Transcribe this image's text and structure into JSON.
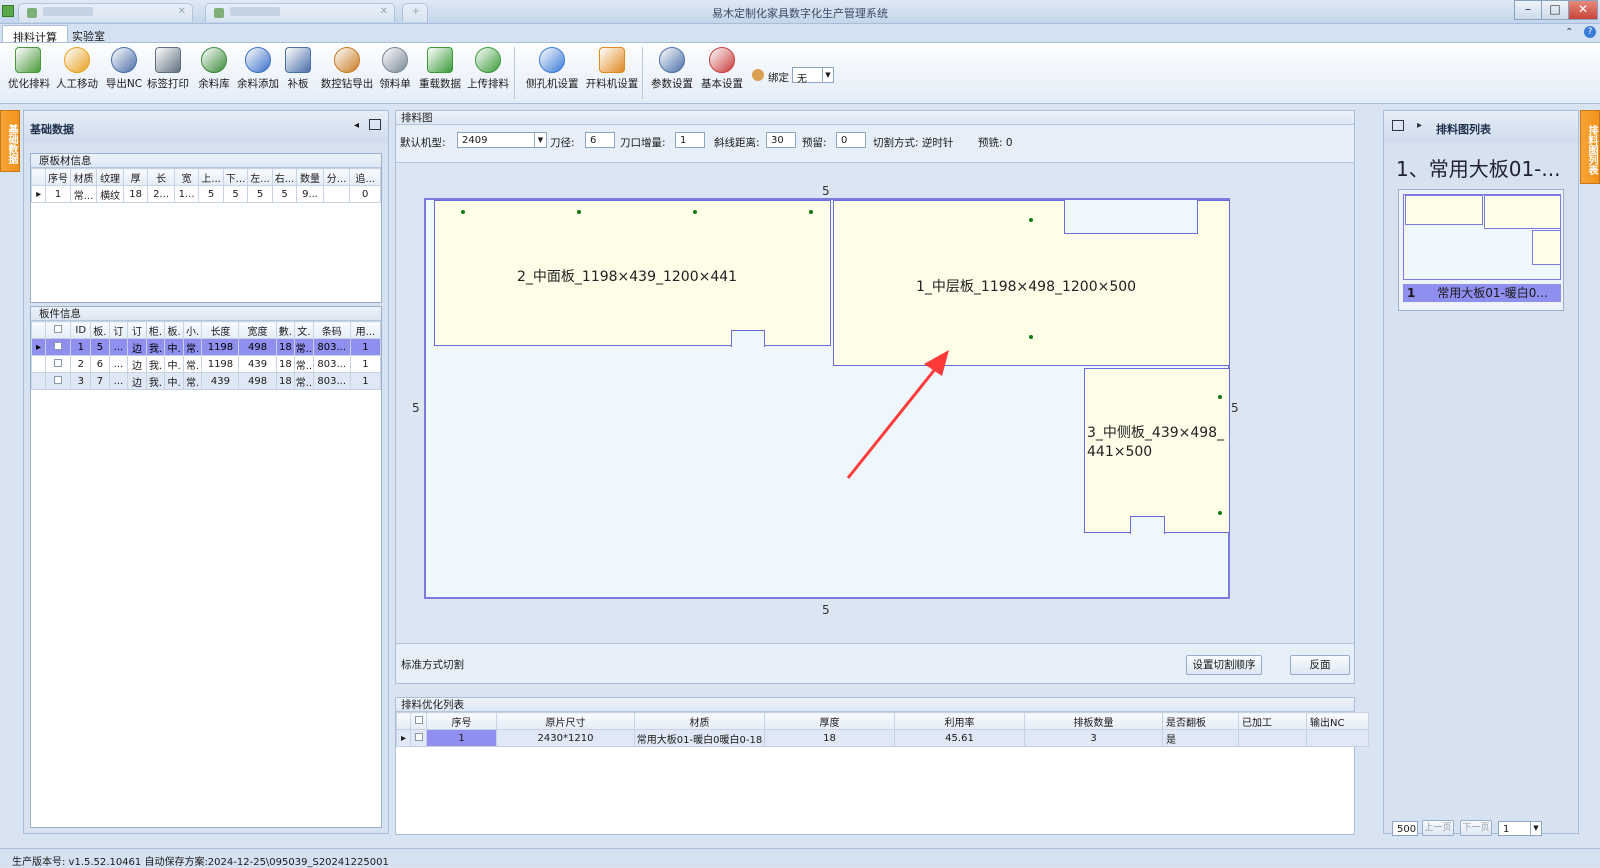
{
  "window": {
    "title": "易木定制化家具数字化生产管理系统"
  },
  "ribbon_tabs": [
    "排料计算",
    "实验室"
  ],
  "toolbar": {
    "buttons": [
      {
        "label": "优化排料",
        "icon": "optimize-icon",
        "color": "#4a9a3a"
      },
      {
        "label": "人工移动",
        "icon": "move-icon",
        "color": "#e8a020"
      },
      {
        "label": "导出NC",
        "icon": "export-nc-icon",
        "color": "#4a6fa8"
      },
      {
        "label": "标签打印",
        "icon": "printer-icon",
        "color": "#607080"
      },
      {
        "label": "余料库",
        "icon": "remnant-store-icon",
        "color": "#3a8a3a"
      },
      {
        "label": "余料添加",
        "icon": "add-circle-icon",
        "color": "#3a6fc8"
      },
      {
        "label": "补板",
        "icon": "patch-board-icon",
        "color": "#4a6fa8"
      },
      {
        "label": "数控钻导出",
        "icon": "drill-export-icon",
        "color": "#c87a20"
      },
      {
        "label": "领料单",
        "icon": "material-slip-icon",
        "color": "#7a8898"
      },
      {
        "label": "重载数据",
        "icon": "reload-icon",
        "color": "#3a9a3a"
      },
      {
        "label": "上传排料",
        "icon": "upload-icon",
        "color": "#3a9a3a"
      },
      {
        "label": "侧孔机设置",
        "icon": "side-drill-icon",
        "color": "#3a7ad8"
      },
      {
        "label": "开料机设置",
        "icon": "cutter-settings-icon",
        "color": "#e08a20"
      },
      {
        "label": "参数设置",
        "icon": "params-icon",
        "color": "#4a6fa8"
      },
      {
        "label": "基本设置",
        "icon": "tools-icon",
        "color": "#c83a3a"
      }
    ],
    "bind_label": "绑定",
    "bind_value": "无"
  },
  "left_panel": {
    "title": "基础数据",
    "side_tab": "基础数据",
    "raw_section": "原板材信息",
    "raw_headers": [
      "序号",
      "材质",
      "纹理",
      "厚",
      "长",
      "宽",
      "上...",
      "下...",
      "左...",
      "右...",
      "数量",
      "分...",
      "追..."
    ],
    "raw_rows": [
      [
        "1",
        "常...",
        "横纹",
        "18",
        "2...",
        "1...",
        "5",
        "5",
        "5",
        "5",
        "9...",
        "",
        "0"
      ]
    ],
    "parts_section": "板件信息",
    "parts_headers": [
      "",
      "ID",
      "板.",
      "订",
      "订",
      "柜.",
      "板.",
      "小.",
      "长度",
      "宽度",
      "數.",
      "文.",
      "条码",
      "用..."
    ],
    "parts_rows": [
      [
        "1",
        "5",
        "...",
        "边",
        "我.",
        "中.",
        "常.",
        "1198",
        "498",
        "18",
        "常..",
        "803...",
        "1"
      ],
      [
        "2",
        "6",
        "...",
        "边",
        "我.",
        "中.",
        "常.",
        "1198",
        "439",
        "18",
        "常..",
        "803...",
        "1"
      ],
      [
        "3",
        "7",
        "...",
        "边",
        "我.",
        "中.",
        "常.",
        "439",
        "498",
        "18",
        "常..",
        "803...",
        "1"
      ]
    ]
  },
  "center": {
    "title": "排料图",
    "params": {
      "machine_label": "默认机型:",
      "machine_value": "2409",
      "diameter_label": "刀径:",
      "diameter_value": "6",
      "kerf_label": "刀口增量:",
      "kerf_value": "1",
      "bevel_label": "斜线距离:",
      "bevel_value": "30",
      "reserve_label": "预留:",
      "reserve_value": "0",
      "cut_mode": "切割方式: 逆时针",
      "trim": "预铣: 0"
    },
    "margins": {
      "top": "5",
      "bottom": "5",
      "left": "5",
      "right": "5"
    },
    "pieces": [
      {
        "label": "2_中面板_1198×439_1200×441"
      },
      {
        "label": "1_中层板_1198×498_1200×500"
      },
      {
        "label": "3_中侧板_439×498_441×500"
      }
    ],
    "footer_text": "标准方式切割",
    "btn_order": "设置切割顺序",
    "btn_reverse": "反面"
  },
  "opt_list": {
    "title": "排料优化列表",
    "headers": [
      "序号",
      "原片尺寸",
      "材质",
      "厚度",
      "利用率",
      "排板数量",
      "是否翻板",
      "已加工",
      "输出NC"
    ],
    "rows": [
      [
        "1",
        "2430*1210",
        "常用大板01-暖白0暖白0-18",
        "18",
        "45.61",
        "3",
        "是",
        "",
        ""
      ]
    ]
  },
  "right_panel": {
    "title": "排料图列表",
    "side_tab": "排料图列表",
    "heading": "1、常用大板01-...",
    "thumb_num": "1",
    "thumb_label": "常用大板01-暖白0...",
    "page_size": "500",
    "prev": "上一页",
    "next": "下一页",
    "page": "1"
  },
  "status": {
    "text": "生产版本号:  v1.5.52.10461    自动保存方案:2024-12-25\\095039_S20241225001"
  }
}
